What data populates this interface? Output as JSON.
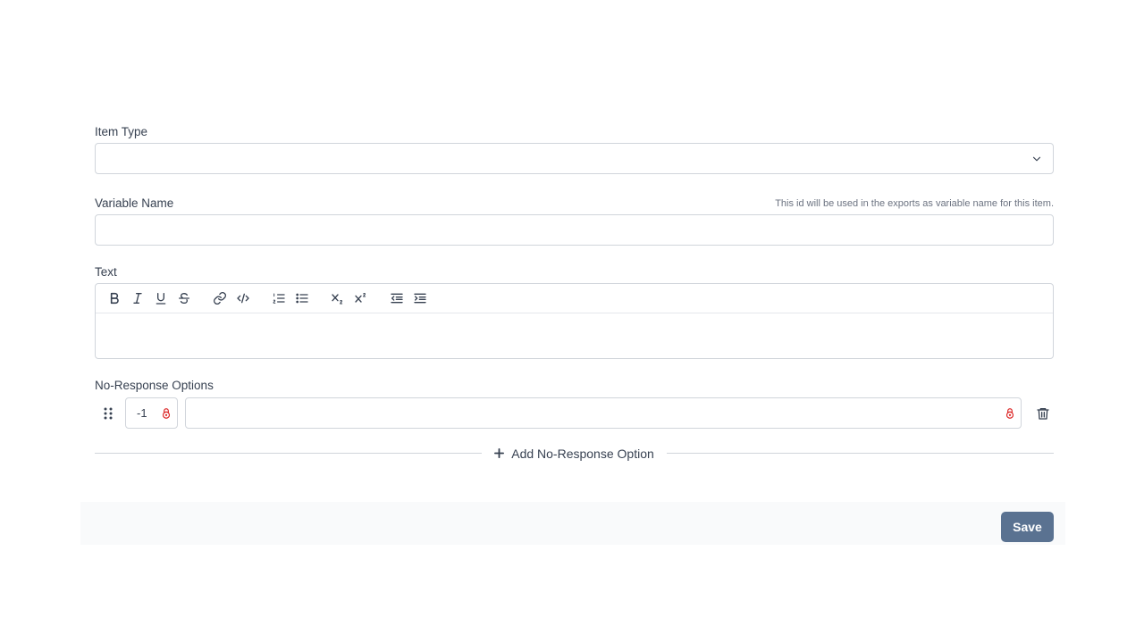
{
  "form": {
    "item_type": {
      "label": "Item Type",
      "value": ""
    },
    "variable_name": {
      "label": "Variable Name",
      "hint": "This id will be used in the exports as variable name for this item.",
      "value": ""
    },
    "text": {
      "label": "Text",
      "toolbar": [
        "bold-icon",
        "italic-icon",
        "underline-icon",
        "strikethrough-icon",
        "link-icon",
        "code-icon",
        "ordered-list-icon",
        "bullet-list-icon",
        "subscript-icon",
        "superscript-icon",
        "outdent-icon",
        "indent-icon"
      ],
      "value": ""
    },
    "no_response": {
      "label": "No-Response Options",
      "options": [
        {
          "code": "-1",
          "label": ""
        }
      ],
      "add_label": "Add No-Response Option"
    }
  },
  "footer": {
    "save_label": "Save"
  },
  "colors": {
    "lock": "#dc2626",
    "save_button": "#5a7291",
    "border": "#d1d5db"
  }
}
